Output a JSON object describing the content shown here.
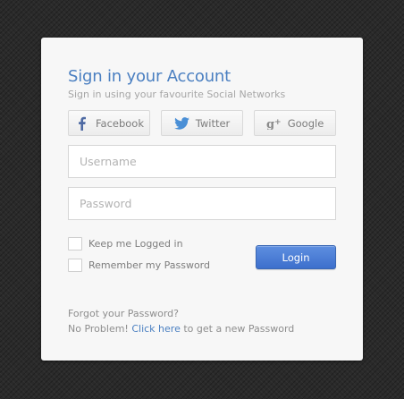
{
  "title": "Sign in your Account",
  "subtitle": "Sign in using your favourite Social Networks",
  "social": {
    "facebook_label": "Facebook",
    "twitter_label": "Twitter",
    "google_label": "Google",
    "facebook_icon": "facebook-icon",
    "twitter_icon": "twitter-icon",
    "google_icon": "google-plus-icon"
  },
  "form": {
    "username_placeholder": "Username",
    "username_value": "",
    "password_placeholder": "Password",
    "password_value": "",
    "keep_logged_label": "Keep me Logged in",
    "keep_logged_checked": false,
    "remember_password_label": "Remember my Password",
    "remember_password_checked": false,
    "login_label": "Login"
  },
  "forgot": {
    "line1": "Forgot your Password?",
    "prefix": "No Problem! ",
    "link_text": "Click here",
    "suffix": " to get a new Password"
  },
  "colors": {
    "accent": "#4a7fc1",
    "login_button": "#4a7bd6",
    "card_background": "#f7f7f7",
    "page_background": "#2a2a2a"
  }
}
